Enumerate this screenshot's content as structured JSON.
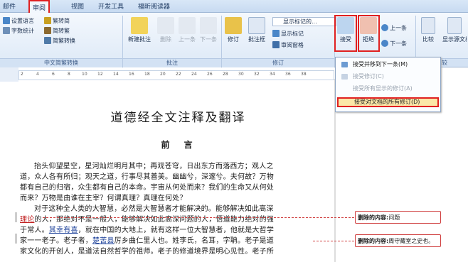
{
  "tabs": [
    {
      "label": "邮件"
    },
    {
      "label": "审阅"
    },
    {
      "label": "视图"
    },
    {
      "label": "开发工具"
    },
    {
      "label": "福昕阅读器"
    }
  ],
  "ribbon": {
    "chinese": {
      "set_language": "设置语言",
      "word_count": "字数统计",
      "to_simplified": "繁转简",
      "to_traditional": "简转繁",
      "convert": "简繁转换",
      "group_label": "中文简繁转换"
    },
    "comments": {
      "new": "新建批注",
      "delete": "删除",
      "prev": "上一条",
      "next": "下一条",
      "group_label": "批注"
    },
    "tracking": {
      "track": "修订",
      "balloons": "批注框",
      "show_markup_final": "显示标记的...",
      "show_markup": "显示标记",
      "review_pane": "审阅窗格",
      "group_label": "修订"
    },
    "changes": {
      "accept": "接受",
      "reject": "拒绝",
      "prev": "上一条",
      "next": "下一条"
    },
    "compare": {
      "compare": "比较",
      "show_source": "显示源文档",
      "group_label": "比较"
    }
  },
  "accept_menu": {
    "items": [
      {
        "label": "接受并移到下一条(M)",
        "enabled": true
      },
      {
        "label": "接受修订(C)",
        "enabled": false
      },
      {
        "label": "接受所有显示的修订(A)",
        "enabled": false
      },
      {
        "label": "接受对文档的所有修订(D)",
        "enabled": true
      }
    ]
  },
  "ruler": {
    "ticks": [
      "2",
      "4",
      "6",
      "8",
      "10",
      "12",
      "14",
      "16",
      "18",
      "20",
      "22",
      "24",
      "26",
      "28",
      "30",
      "32",
      "34",
      "36",
      "38"
    ]
  },
  "document": {
    "title": "道德经全文注释及翻译",
    "subtitle": "前　言",
    "p1": [
      "抬头仰望星空，星河灿烂明月其中；再观苍穹，日出东方而落西方；观人之",
      "道，众人各有所归；观天之道，行事尽其善美。幽幽兮，深邃兮。夫何故？万物",
      "都有自己的归宿，众生都有自己的本命。宇宙从何处而来？我们的生命又从何处",
      "而来？万物是由谁在主宰？何谓真理？真理在何处？"
    ],
    "p2_l1": "对于这种全人类的大智慧，必然是大智慧者才能解决的。能够解决如此高深",
    "p2_l2_del": "理论",
    "p2_l2_rest": "的人，那绝对不是一般人，能够解决如此高深问题的人，悟道能力绝对的强",
    "p2_l3_a": "于常人。",
    "p2_l3_ins": "其幸有喜",
    "p2_l3_b": "，就在中国的大地上，就有这样一位大智慧者，他就是大哲学",
    "p2_l4_a": "家一一老子。老子者，",
    "p2_l4_ins": "楚苦县",
    "p2_l4_b": "厉乡曲仁里人也。姓李氏，名耳，字聃。老子是道",
    "p2_l5": "家文化的开创人，是道法自然哲学的祖师。老子的修道境界是明心见性。老子所"
  },
  "comments": [
    {
      "label": "删除的内容:",
      "text": "问题"
    },
    {
      "label": "删除的内容:",
      "text": "周守藏室之史也。"
    }
  ]
}
